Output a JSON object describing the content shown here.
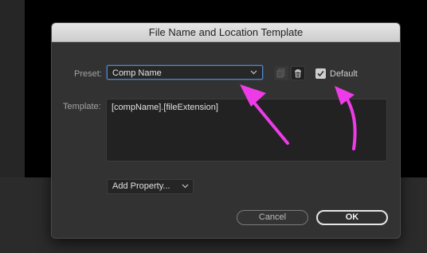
{
  "dialog": {
    "title": "File Name and Location Template",
    "preset": {
      "label": "Preset:",
      "value": "Comp Name"
    },
    "default": {
      "label": "Default",
      "checked": true
    },
    "template": {
      "label": "Template:",
      "value": "[compName].[fileExtension]"
    },
    "add_property": {
      "label": "Add Property..."
    },
    "buttons": {
      "cancel": "Cancel",
      "ok": "OK"
    }
  },
  "annotations": {
    "arrow_color": "#ee3be8"
  },
  "icons": {
    "duplicate": "duplicate-icon",
    "trash": "trash-icon",
    "chevron": "chevron-down-icon",
    "check": "checkmark-icon"
  }
}
